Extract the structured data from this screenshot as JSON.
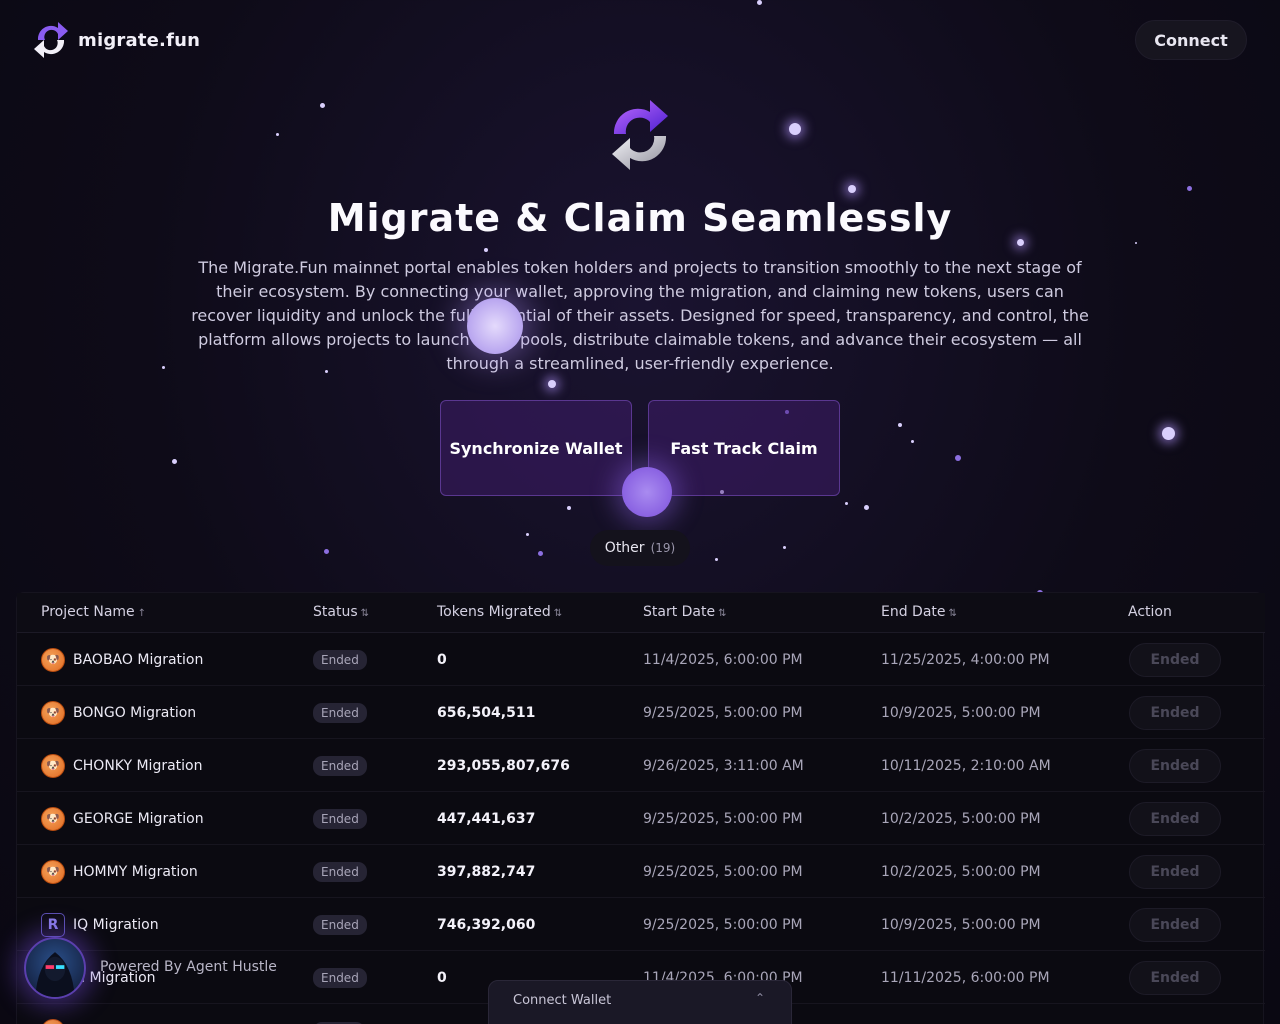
{
  "header": {
    "logo_text": "migrate.fun",
    "connect_label": "Connect"
  },
  "hero": {
    "title": "Migrate & Claim Seamlessly",
    "description": "The Migrate.Fun mainnet portal enables token holders and projects to transition smoothly to the next stage of their ecosystem. By connecting your wallet, approving the migration, and claiming new tokens, users can recover liquidity and unlock the full potential of their assets. Designed for speed, transparency, and control, the platform allows projects to launch fresh pools, distribute claimable tokens, and advance their ecosystem — all through a streamlined, user-friendly experience.",
    "sync_label": "Synchronize Wallet",
    "fast_label": "Fast Track Claim"
  },
  "filter": {
    "label": "Other",
    "count": "(19)"
  },
  "table": {
    "headers": {
      "name": "Project Name",
      "status": "Status",
      "tokens": "Tokens Migrated",
      "start": "Start Date",
      "end": "End Date",
      "action": "Action"
    },
    "rows": [
      {
        "name": "BAOBAO Migration",
        "status": "Ended",
        "tokens": "0",
        "start": "11/4/2025, 6:00:00 PM",
        "end": "11/25/2025, 4:00:00 PM",
        "action": "Ended",
        "icon": "token-icon"
      },
      {
        "name": "BONGO Migration",
        "status": "Ended",
        "tokens": "656,504,511",
        "start": "9/25/2025, 5:00:00 PM",
        "end": "10/9/2025, 5:00:00 PM",
        "action": "Ended",
        "icon": "token-icon"
      },
      {
        "name": "CHONKY Migration",
        "status": "Ended",
        "tokens": "293,055,807,676",
        "start": "9/26/2025, 3:11:00 AM",
        "end": "10/11/2025, 2:10:00 AM",
        "action": "Ended",
        "icon": "token-icon"
      },
      {
        "name": "GEORGE Migration",
        "status": "Ended",
        "tokens": "447,441,637",
        "start": "9/25/2025, 5:00:00 PM",
        "end": "10/2/2025, 5:00:00 PM",
        "action": "Ended",
        "icon": "token-icon"
      },
      {
        "name": "HOMMY Migration",
        "status": "Ended",
        "tokens": "397,882,747",
        "start": "9/25/2025, 5:00:00 PM",
        "end": "10/2/2025, 5:00:00 PM",
        "action": "Ended",
        "icon": "token-icon"
      },
      {
        "name": "IQ Migration",
        "status": "Ended",
        "tokens": "746,392,060",
        "start": "9/25/2025, 5:00:00 PM",
        "end": "10/9/2025, 5:00:00 PM",
        "action": "Ended",
        "icon": "iq-icon"
      },
      {
        "name": "M Migration",
        "status": "Ended",
        "tokens": "0",
        "start": "11/4/2025, 6:00:00 PM",
        "end": "11/11/2025, 6:00:00 PM",
        "action": "Ended",
        "icon": "token-icon"
      }
    ]
  },
  "agent": {
    "label": "Powered By Agent Hustle"
  },
  "connect_panel": {
    "label": "Connect Wallet",
    "chevron": "⌃"
  },
  "colors": {
    "background": "#0e0b18",
    "accent_purple": "#5a3790",
    "badge_bg": "#262434"
  }
}
